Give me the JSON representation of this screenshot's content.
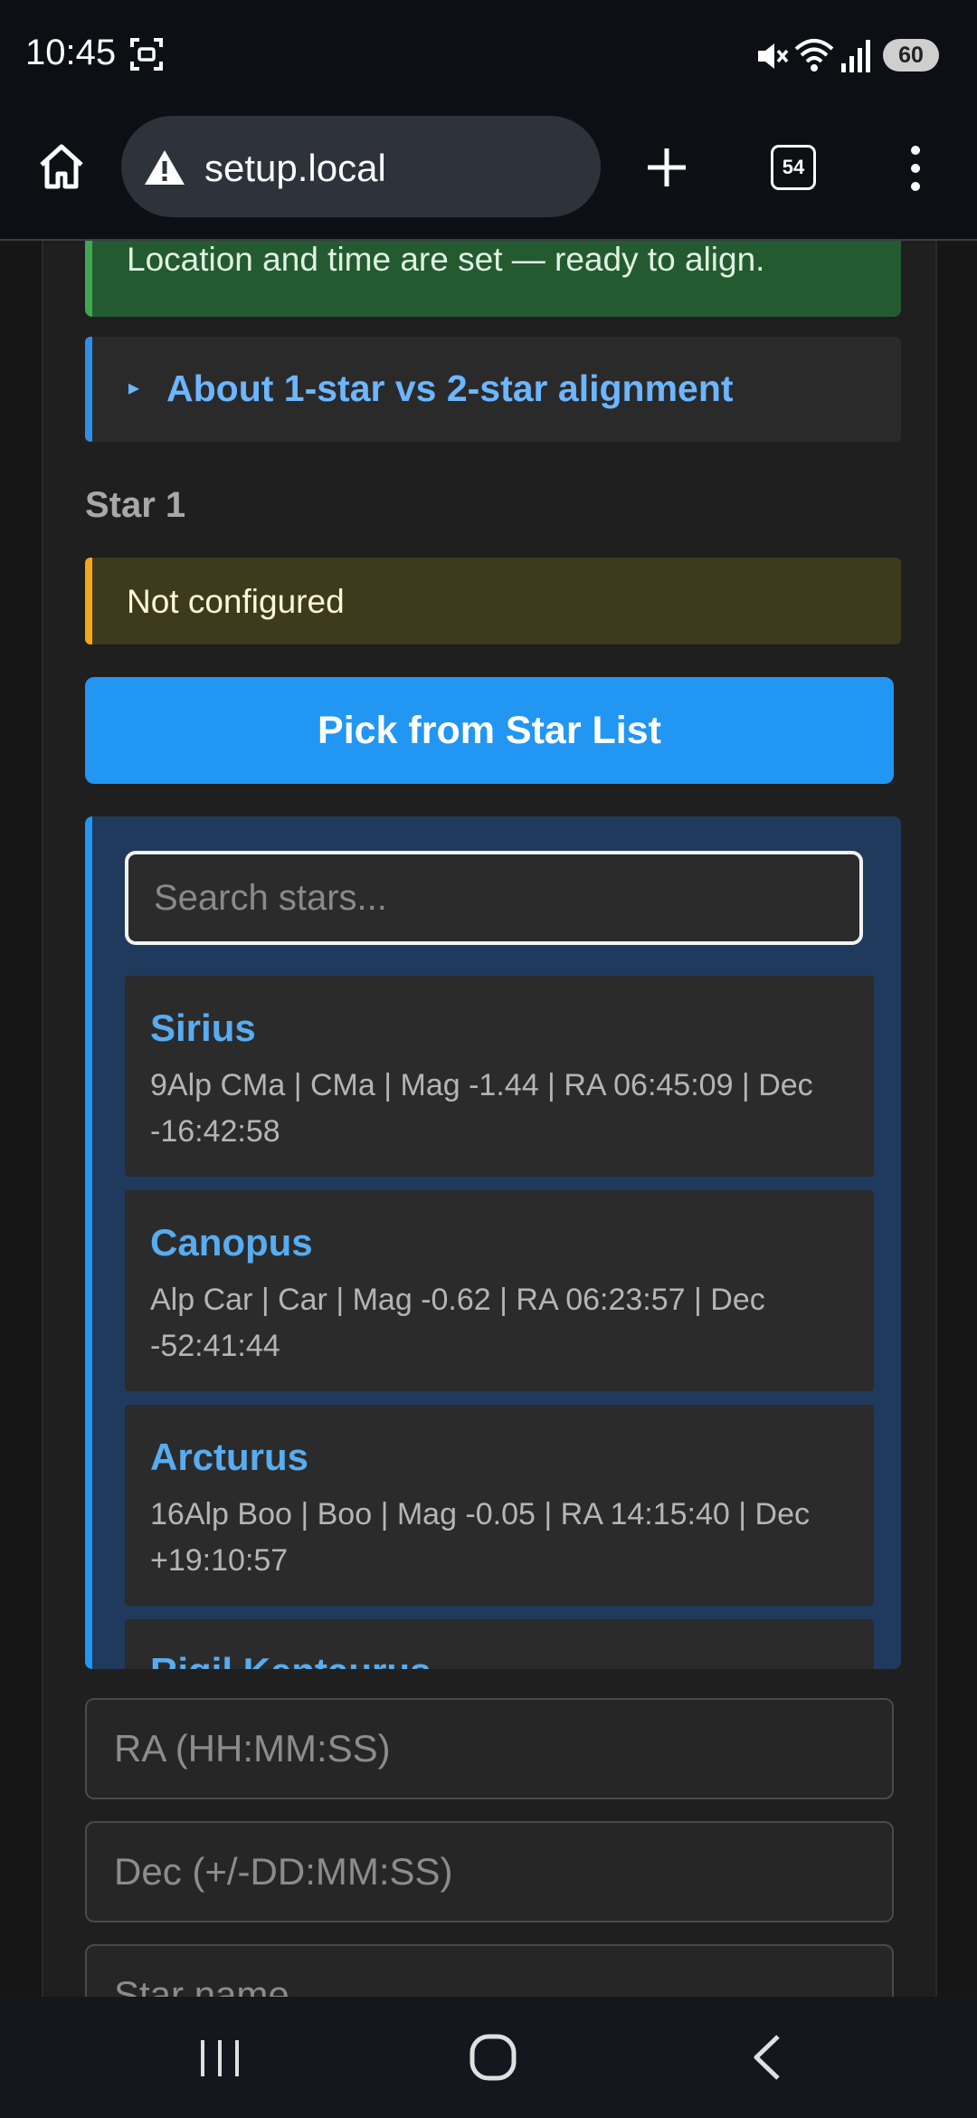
{
  "status_bar": {
    "time": "10:45",
    "battery": "60",
    "icons": [
      "screenshot-icon",
      "mute-icon",
      "wifi-icon",
      "signal-icon"
    ]
  },
  "browser": {
    "url": "setup.local",
    "tab_count": "54",
    "icons": [
      "home-icon",
      "warning-icon",
      "plus-icon",
      "tabs-icon",
      "menu-icon"
    ]
  },
  "content": {
    "success_message": "Location and time are set — ready to align.",
    "details_arrow": "▸",
    "details_summary": "About 1-star vs 2-star alignment",
    "section_title": "Star 1",
    "status_message": "Not configured",
    "pick_button_label": "Pick from Star List",
    "search_placeholder": "Search stars...",
    "stars": [
      {
        "name": "Sirius",
        "details": "9Alp CMa | CMa | Mag -1.44 | RA 06:45:09 | Dec -16:42:58"
      },
      {
        "name": "Canopus",
        "details": "Alp Car | Car | Mag -0.62 | RA 06:23:57 | Dec -52:41:44"
      },
      {
        "name": "Arcturus",
        "details": "16Alp Boo | Boo | Mag -0.05 | RA 14:15:40 | Dec +19:10:57"
      },
      {
        "name": "Rigil Kentaurus",
        "details": ""
      }
    ],
    "ra_placeholder": "RA (HH:MM:SS)",
    "dec_placeholder": "Dec (+/-DD:MM:SS)",
    "name_placeholder": "Star name"
  },
  "colors": {
    "success": "#245a30",
    "info_accent": "#2f8fe8",
    "warning_accent": "#f0a818",
    "primary_button": "#2196f3",
    "star_name": "#58acf0"
  },
  "nav_icons": [
    "recents-icon",
    "home-nav-icon",
    "back-icon"
  ]
}
